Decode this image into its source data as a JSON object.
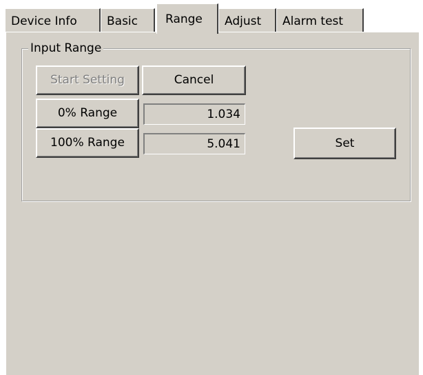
{
  "tabs": [
    {
      "label": "Device Info",
      "selected": false
    },
    {
      "label": "Basic",
      "selected": false
    },
    {
      "label": "Range",
      "selected": true
    },
    {
      "label": "Adjust",
      "selected": false
    },
    {
      "label": "Alarm test",
      "selected": false
    }
  ],
  "input_range": {
    "group_title": "Input Range",
    "start_setting_label": "Start Setting",
    "cancel_label": "Cancel",
    "range_0_label": "0% Range",
    "range_0_value": "1.034",
    "range_100_label": "100% Range",
    "range_100_value": "5.041",
    "set_label": "Set"
  },
  "colors": {
    "face": "#d4d0c8",
    "highlight": "#ffffff",
    "shadow": "#808080",
    "dark_shadow": "#404040",
    "disabled_text": "#808080"
  }
}
